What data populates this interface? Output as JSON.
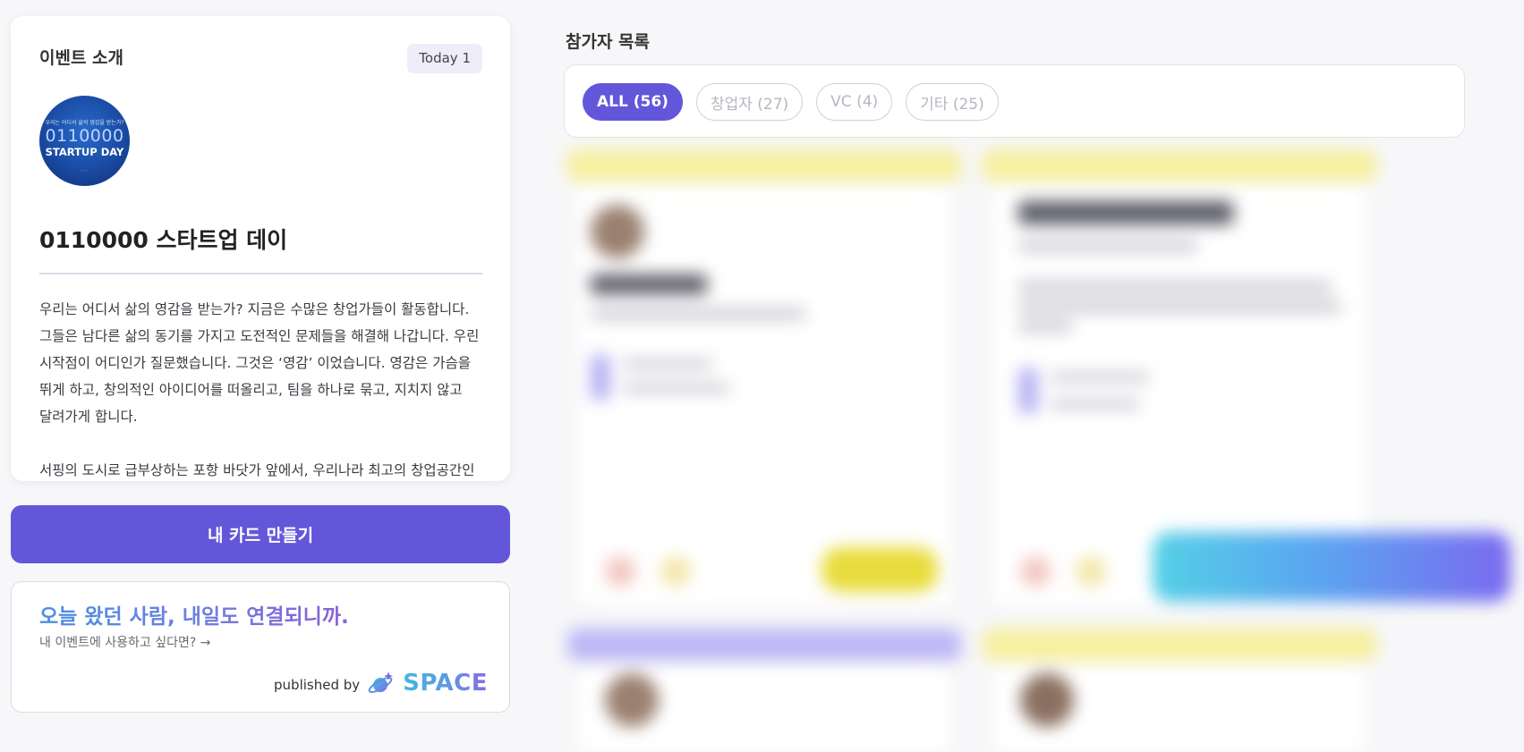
{
  "event": {
    "section_label": "이벤트 소개",
    "today_badge": "Today 1",
    "logo": {
      "tagline": "우리는 어디서 삶의 영감을 받는가?",
      "number": "0110000",
      "word": "STARTUP DAY",
      "footer": "· ·  ·"
    },
    "title": "0110000 스타트업 데이",
    "description": [
      "우리는 어디서 삶의 영감을 받는가? 지금은 수많은 창업가들이 활동합니다. 그들은 남다른 삶의 동기를 가지고 도전적인 문제들을 해결해 나갑니다. 우린 시작점이 어디인가 질문했습니다. 그것은 ‘영감’ 이었습니다. 영감은 가슴을 뛰게 하고, 창의적인 아이디어를 떠올리고, 팀을 하나로 묶고, 지치지 않고 달려가게 합니다.",
      "서핑의 도시로 급부상하는 포항 바닷가 앞에서, 우리나라 최고의 창업공간인 체인지업그라운드, 그리고 배워서 남주자는 미션의 한동대학교에서"
    ]
  },
  "cta": {
    "label": "내 카드 만들기"
  },
  "promo": {
    "headline": "오늘 왔던 사람, 내일도 연결되니까.",
    "link": "내 이벤트에 사용하고 싶다면? →",
    "published_by": "published by",
    "brand": "SPACE"
  },
  "participants": {
    "title": "참가자 목록",
    "filters": [
      {
        "label": "ALL (56)",
        "active": true
      },
      {
        "label": "창업자 (27)",
        "active": false
      },
      {
        "label": "VC (4)",
        "active": false
      },
      {
        "label": "기타 (25)",
        "active": false
      }
    ]
  },
  "colors": {
    "accent": "#6357d9",
    "badge_bg": "#eeedfa",
    "band_yellow": "#f6ef9e",
    "band_purple": "#bcb7f5"
  }
}
